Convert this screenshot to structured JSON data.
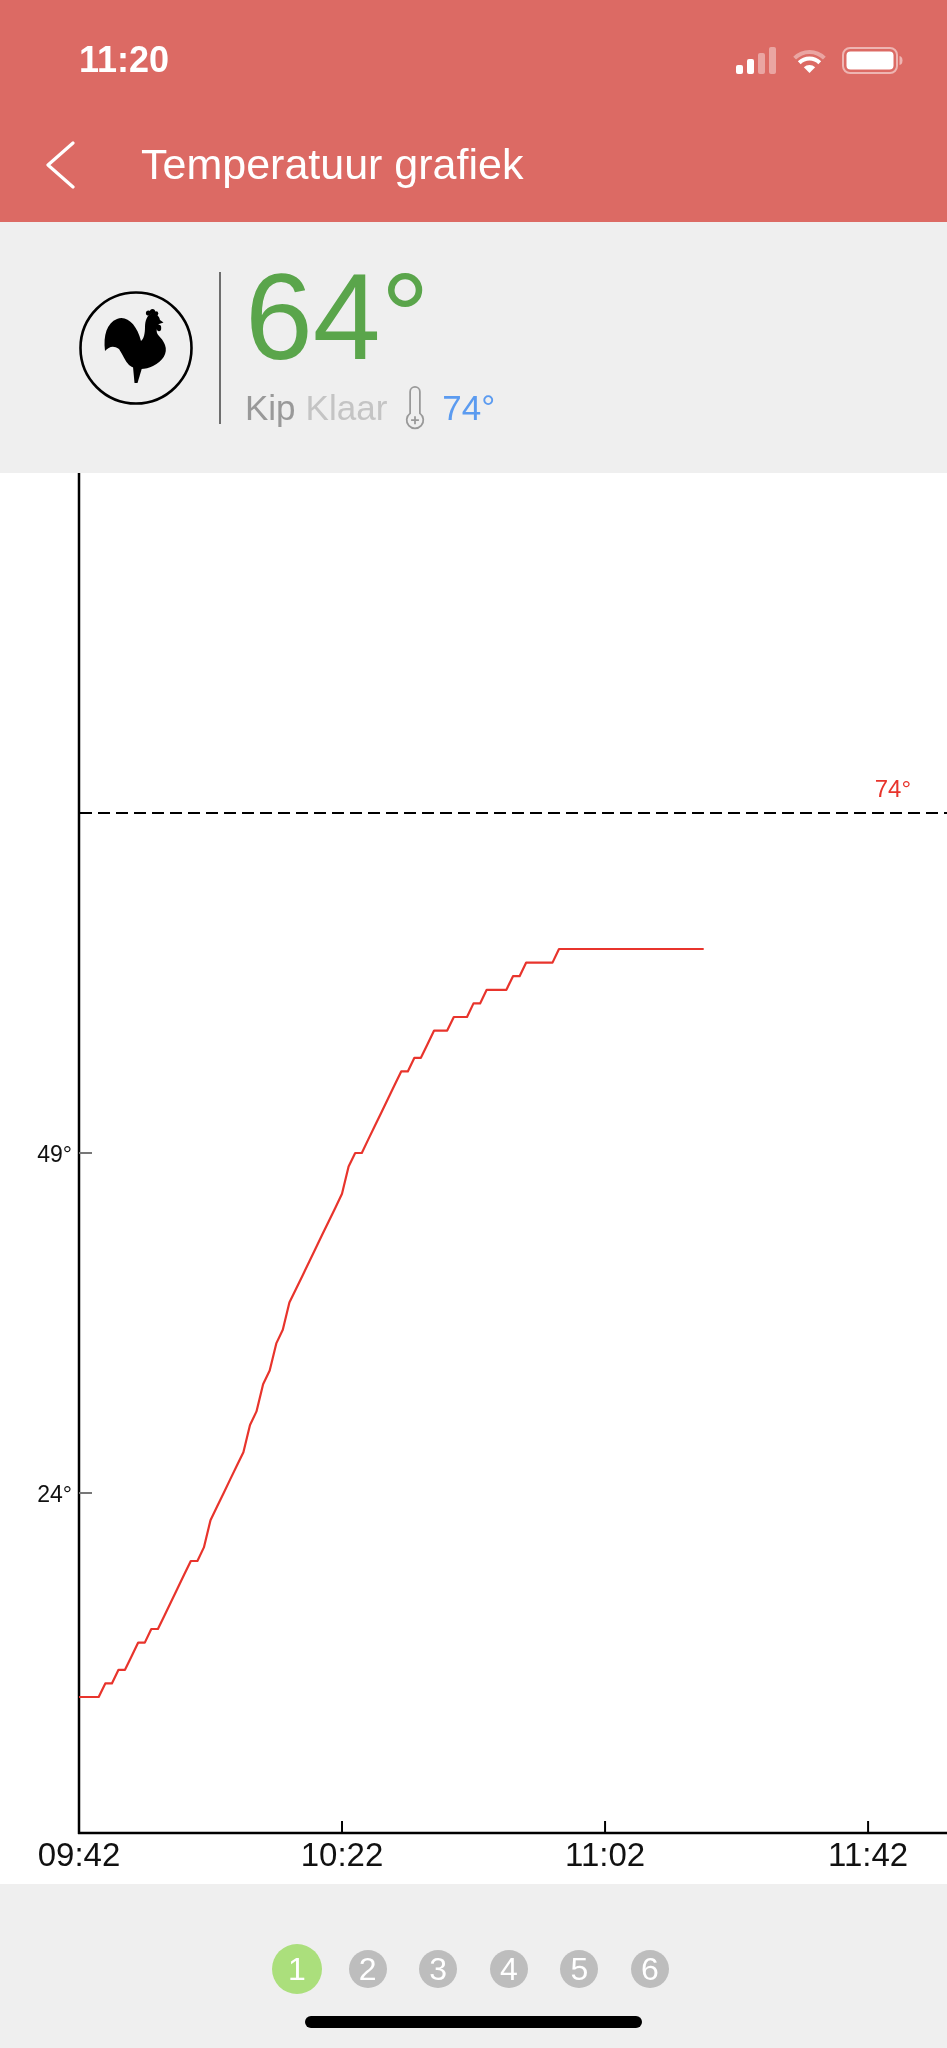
{
  "status_bar": {
    "time": "11:20"
  },
  "nav_bar": {
    "title": "Temperatuur grafiek"
  },
  "probe": {
    "temperature": "64°",
    "meat": "Kip",
    "doneness": "Klaar",
    "target": "74°"
  },
  "chart": {
    "chart_data": {
      "type": "line",
      "categories": [
        "09:42",
        null,
        null,
        null,
        null,
        null,
        null,
        null,
        null,
        null,
        null,
        null,
        null,
        null,
        null,
        null,
        null,
        null,
        null,
        null,
        null,
        null,
        null,
        null,
        null,
        null,
        null,
        null,
        null,
        null,
        null,
        null,
        null,
        null,
        null,
        null,
        null,
        null,
        null,
        null,
        "10:22",
        null,
        null,
        null,
        null,
        null,
        null,
        null,
        null,
        null,
        null,
        null,
        null,
        null,
        null,
        null,
        null,
        null,
        null,
        null,
        null,
        null,
        null,
        null,
        null,
        null,
        null,
        null,
        null,
        null,
        null,
        null,
        null,
        null,
        null,
        null,
        null,
        null,
        null,
        null,
        "11:02",
        null,
        null,
        null,
        null,
        null,
        null,
        null,
        null,
        null,
        null,
        null,
        null,
        null,
        null,
        null,
        null,
        null,
        null,
        null,
        null,
        null,
        null,
        null,
        null,
        null,
        null,
        null,
        null,
        null,
        null,
        null,
        null,
        null,
        null,
        null,
        null,
        null,
        null,
        null,
        "11:42",
        null,
        null,
        null,
        null,
        null,
        null,
        null,
        null,
        null,
        null,
        null,
        null
      ],
      "series": [
        {
          "color": "#e8342c",
          "values": [
            9,
            9,
            9,
            9,
            10,
            10,
            11,
            11,
            12,
            13,
            13,
            14,
            14,
            15,
            16,
            17,
            18,
            19,
            19,
            20,
            22,
            23,
            24,
            25,
            26,
            27,
            29,
            30,
            32,
            33,
            35,
            36,
            38,
            39,
            40,
            41,
            42,
            43,
            44,
            45,
            46,
            48,
            49,
            49,
            50,
            51,
            52,
            53,
            54,
            55,
            55,
            56,
            56,
            57,
            58,
            58,
            58,
            59,
            59,
            59,
            60,
            60,
            61,
            61,
            61,
            61,
            62,
            62,
            63,
            63,
            63,
            63,
            63,
            64,
            64,
            64,
            64,
            64,
            64,
            64,
            64,
            64,
            64,
            64,
            64,
            64,
            64,
            64,
            64,
            64,
            64,
            64,
            64,
            64,
            64,
            64,
            null,
            null,
            null,
            null,
            null,
            null,
            null,
            null,
            null,
            null,
            null,
            null,
            null,
            null,
            null,
            null,
            null,
            null,
            null,
            null,
            null,
            null,
            null,
            null,
            null,
            null,
            null,
            null,
            null,
            null,
            null,
            null,
            null,
            null,
            null,
            null,
            null
          ]
        }
      ],
      "ylim": [
        -1,
        99
      ],
      "yticks": [
        {
          "value": 24,
          "label": "24°"
        },
        {
          "value": 49,
          "label": "49°"
        }
      ],
      "ref_lines": [
        {
          "axis": "y",
          "value": 74,
          "label": "74°"
        }
      ]
    }
  },
  "pager": {
    "pages": [
      {
        "label": "1",
        "selected": true
      },
      {
        "label": "2",
        "selected": false
      },
      {
        "label": "3",
        "selected": false
      },
      {
        "label": "4",
        "selected": false
      },
      {
        "label": "5",
        "selected": false
      },
      {
        "label": "6",
        "selected": false
      }
    ]
  }
}
